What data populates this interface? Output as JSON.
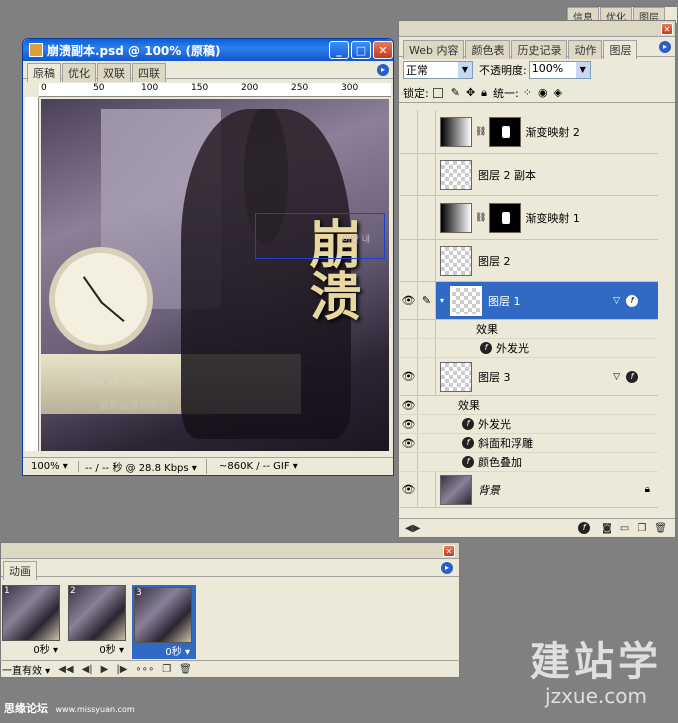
{
  "doc_window": {
    "title": "崩溃副本.psd @ 100% (原稿)",
    "tabs": [
      "原稿",
      "优化",
      "双联",
      "四联"
    ],
    "ruler_ticks": [
      "0",
      "50",
      "100",
      "150",
      "200",
      "250",
      "300"
    ],
    "status_zoom": "100%",
    "status_speed": "-- / -- 秒 @ 28.8 Kbps",
    "status_size": "~860K / -- GIF",
    "canvas_text_big": "崩溃",
    "canvas_text_small1": "FOUR FALLING",
    "canvas_text_small2": "谁和谁擦肩而过。",
    "canvas_text_box": "미안 내"
  },
  "layers_panel": {
    "tabs": [
      "Web 内容",
      "颜色表",
      "历史记录",
      "动作",
      "图层"
    ],
    "blend_mode": "正常",
    "opacity_label": "不透明度:",
    "opacity_value": "100%",
    "lock_label": "锁定:",
    "unify_label": "统一:",
    "layers": [
      {
        "name": "渐变映射 2",
        "type": "adjust"
      },
      {
        "name": "图层 2 副本",
        "type": "layer"
      },
      {
        "name": "渐变映射 1",
        "type": "adjust"
      },
      {
        "name": "图层 2",
        "type": "layer"
      },
      {
        "name": "图层 1",
        "type": "layer"
      },
      {
        "name": "图层 3",
        "type": "layer"
      },
      {
        "name": "背景",
        "type": "background"
      }
    ],
    "layer1_effects_label": "效果",
    "layer1_effects": [
      "外发光"
    ],
    "layer3_effects_label": "效果",
    "layer3_effects": [
      "外发光",
      "斜面和浮雕",
      "颜色叠加"
    ]
  },
  "animation_panel": {
    "title": "动画",
    "frames": [
      {
        "num": "1",
        "delay": "0秒"
      },
      {
        "num": "2",
        "delay": "0秒"
      },
      {
        "num": "3",
        "delay": "0秒"
      }
    ],
    "loop": "一直有效"
  },
  "watermark": {
    "left_cn": "思缘论坛",
    "left_url": "www.missyuan.com",
    "right_cn": "建站学",
    "right_url": "jzxue.com"
  },
  "top_tabs_partial": [
    "信息",
    "优化",
    "图层"
  ],
  "colors": {
    "selected_layer": "#316ac5",
    "titlebar": "#0a5fd8"
  }
}
